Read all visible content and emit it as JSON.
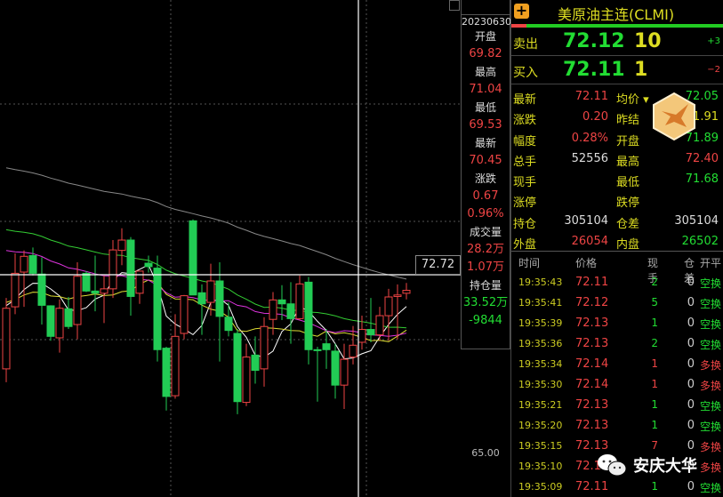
{
  "chart": {
    "crosshair_price": "72.72",
    "axis_label": "65.00"
  },
  "info": {
    "date": "20230630",
    "items": [
      {
        "label": "开盘",
        "value": "69.82",
        "color": "red"
      },
      {
        "label": "最高",
        "value": "71.04",
        "color": "red"
      },
      {
        "label": "最低",
        "value": "69.53",
        "color": "red"
      },
      {
        "label": "最新",
        "value": "70.45",
        "color": "red"
      },
      {
        "label": "涨跌",
        "value": "0.67",
        "color": "red",
        "value2": "0.96%"
      },
      {
        "label": "成交量",
        "value": "28.2万",
        "color": "red",
        "value2": "1.07万"
      },
      {
        "label": "持仓量",
        "value": "33.52万",
        "color": "green",
        "value2": "-9844"
      }
    ]
  },
  "panel": {
    "title": "美原油主连(CLMI)",
    "sell": {
      "label": "卖出",
      "price": "72.12",
      "volume": "10",
      "change": "+3"
    },
    "buy": {
      "label": "买入",
      "price": "72.11",
      "volume": "1",
      "change": "−2"
    },
    "stats": [
      {
        "l1": "最新",
        "v1": "72.11",
        "c1": "red",
        "l2": "均价 ▾",
        "v2": "72.05",
        "c2": "green"
      },
      {
        "l1": "涨跌",
        "v1": "0.20",
        "c1": "red",
        "l2": "昨结",
        "v2": "71.91",
        "c2": "yellow"
      },
      {
        "l1": "幅度",
        "v1": "0.28%",
        "c1": "red",
        "l2": "开盘",
        "v2": "71.89",
        "c2": "green"
      },
      {
        "l1": "总手",
        "v1": "52556",
        "c1": "white",
        "l2": "最高",
        "v2": "72.40",
        "c2": "red"
      },
      {
        "l1": "现手",
        "v1": "",
        "c1": "white",
        "l2": "最低",
        "v2": "71.68",
        "c2": "green"
      },
      {
        "l1": "涨停",
        "v1": "",
        "c1": "white",
        "l2": "跌停",
        "v2": "",
        "c2": "white"
      },
      {
        "l1": "持仓",
        "v1": "305104",
        "c1": "white",
        "l2": "仓差",
        "v2": "305104",
        "c2": "white"
      },
      {
        "l1": "外盘",
        "v1": "26054",
        "c1": "red",
        "l2": "内盘",
        "v2": "26502",
        "c2": "green"
      }
    ],
    "tick_headers": [
      "时间",
      "价格",
      "现手",
      "仓差",
      "开平"
    ],
    "ticks": [
      [
        "19:35:43",
        "72.11",
        "2",
        "0",
        "空换",
        "green"
      ],
      [
        "19:35:41",
        "72.12",
        "5",
        "0",
        "空换",
        "green"
      ],
      [
        "19:35:39",
        "72.13",
        "1",
        "0",
        "空换",
        "green"
      ],
      [
        "19:35:36",
        "72.13",
        "2",
        "0",
        "空换",
        "green"
      ],
      [
        "19:35:34",
        "72.14",
        "1",
        "0",
        "多换",
        "red"
      ],
      [
        "19:35:30",
        "72.14",
        "1",
        "0",
        "多换",
        "red"
      ],
      [
        "19:35:21",
        "72.13",
        "1",
        "0",
        "空换",
        "green"
      ],
      [
        "19:35:20",
        "72.13",
        "1",
        "0",
        "空换",
        "green"
      ],
      [
        "19:35:15",
        "72.13",
        "7",
        "0",
        "多换",
        "red"
      ],
      [
        "19:35:10",
        "72.1",
        "",
        "0",
        "多换",
        "red"
      ],
      [
        "19:35:09",
        "72.11",
        "1",
        "0",
        "空换",
        "green"
      ]
    ]
  },
  "watermark": "安庆大华",
  "colors": {
    "up": "#ee4444",
    "down": "#22cc55",
    "ma5": "#ffffff",
    "ma10": "#dddd33",
    "ma20": "#dd33dd",
    "ma30": "#33cc33",
    "ma60": "#888888"
  },
  "chart_data": {
    "type": "candlestick",
    "ylim": [
      65,
      75
    ],
    "ytick": "65.00",
    "hline": 72.72,
    "ohlc": [
      [
        68.47,
        71.35,
        67.93,
        70.93
      ],
      [
        70.99,
        73.16,
        70.69,
        72.35
      ],
      [
        72.4,
        73.28,
        70.99,
        73.04
      ],
      [
        73.07,
        73.4,
        72.26,
        72.35
      ],
      [
        72.32,
        73.0,
        70.27,
        71.05
      ],
      [
        71.03,
        71.05,
        69.61,
        69.79
      ],
      [
        69.73,
        71.29,
        69.13,
        70.93
      ],
      [
        70.91,
        71.39,
        70.09,
        70.19
      ],
      [
        70.27,
        72.8,
        69.67,
        72.23
      ],
      [
        72.35,
        72.44,
        71.59,
        71.63
      ],
      [
        71.63,
        73.07,
        70.81,
        71.54
      ],
      [
        71.54,
        72.26,
        70.33,
        71.72
      ],
      [
        71.72,
        73.7,
        71.35,
        73.3
      ],
      [
        73.28,
        74.18,
        72.68,
        73.7
      ],
      [
        73.7,
        73.82,
        70.63,
        71.41
      ],
      [
        71.54,
        72.44,
        71.11,
        72.44
      ],
      [
        72.76,
        73.07,
        72.38,
        72.62
      ],
      [
        72.56,
        73.07,
        68.77,
        69.25
      ],
      [
        69.31,
        69.37,
        66.78,
        67.35
      ],
      [
        67.38,
        70.69,
        67.26,
        69.79
      ],
      [
        69.91,
        71.47,
        69.67,
        71.44
      ],
      [
        74.48,
        74.54,
        71.47,
        71.47
      ],
      [
        71.56,
        71.9,
        69.85,
        71.11
      ],
      [
        71.17,
        72.74,
        70.63,
        72.04
      ],
      [
        72.04,
        72.8,
        68.77,
        70.6
      ],
      [
        70.57,
        71.17,
        69.79,
        70.03
      ],
      [
        69.91,
        70.09,
        66.63,
        67.14
      ],
      [
        67.11,
        69.49,
        66.96,
        68.95
      ],
      [
        69.03,
        69.79,
        67.87,
        68.41
      ],
      [
        68.47,
        70.57,
        67.75,
        70.19
      ],
      [
        70.48,
        71.59,
        69.85,
        71.27
      ],
      [
        71.27,
        71.87,
        70.45,
        71.11
      ],
      [
        71.11,
        71.99,
        69.49,
        70.51
      ],
      [
        70.51,
        72.26,
        70.45,
        71.92
      ],
      [
        71.99,
        72.2,
        68.65,
        69.25
      ],
      [
        69.25,
        69.37,
        67.14,
        69.21
      ],
      [
        69.49,
        70.09,
        68.47,
        69.25
      ],
      [
        69.19,
        69.49,
        67.26,
        67.81
      ],
      [
        67.81,
        69.49,
        66.84,
        68.86
      ],
      [
        68.95,
        70.21,
        68.65,
        69.43
      ],
      [
        69.55,
        70.63,
        69.25,
        70.07
      ],
      [
        70.07,
        71.35,
        69.55,
        69.85
      ],
      [
        69.85,
        70.99,
        69.61,
        70.63
      ],
      [
        70.63,
        71.72,
        69.61,
        71.39
      ],
      [
        71.41,
        71.9,
        69.67,
        71.47
      ],
      [
        71.54,
        71.96,
        71.29,
        71.66
      ]
    ]
  }
}
